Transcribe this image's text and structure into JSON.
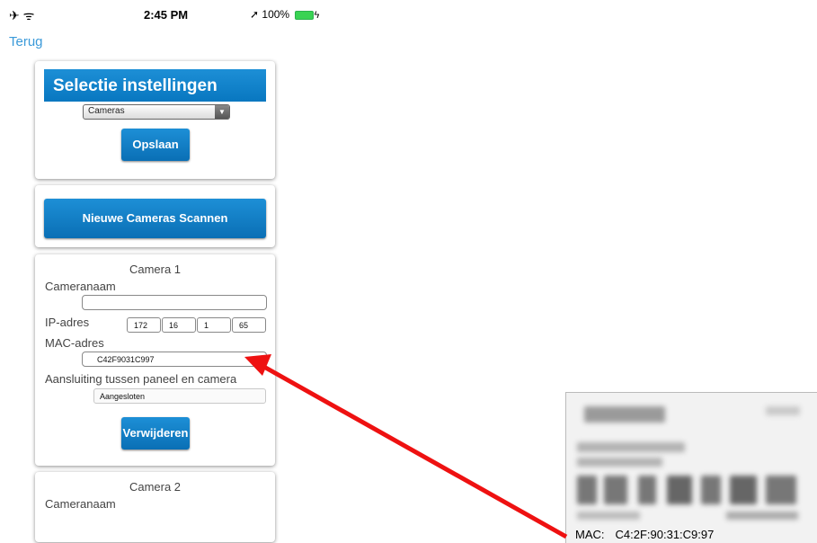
{
  "status_bar": {
    "left_icons": "✈ ᯤ",
    "time": "2:45 PM",
    "battery": "100%"
  },
  "nav": {
    "back_label": "Terug"
  },
  "selection_card": {
    "title": "Selectie instellingen",
    "dropdown_value": "Cameras",
    "save_label": "Opslaan"
  },
  "scan_card": {
    "button_label": "Nieuwe Cameras Scannen"
  },
  "camera1": {
    "title": "Camera 1",
    "name_label": "Cameranaam",
    "name_value": "",
    "ip_label": "IP-adres",
    "ip": [
      "172",
      "16",
      "1",
      "65"
    ],
    "mac_label": "MAC-adres",
    "mac_value": "C42F9031C997",
    "connection_label": "Aansluiting tussen paneel en camera",
    "connection_value": "Aangesloten",
    "delete_label": "Verwijderen"
  },
  "camera2": {
    "title": "Camera 2",
    "name_label": "Cameranaam"
  },
  "label_photo": {
    "mac_key": "MAC:",
    "mac_value": "C4:2F:90:31:C9:97"
  },
  "colors": {
    "accent": "#0a7cc4",
    "link": "#3b9ad9",
    "arrow": "#ee1111"
  }
}
